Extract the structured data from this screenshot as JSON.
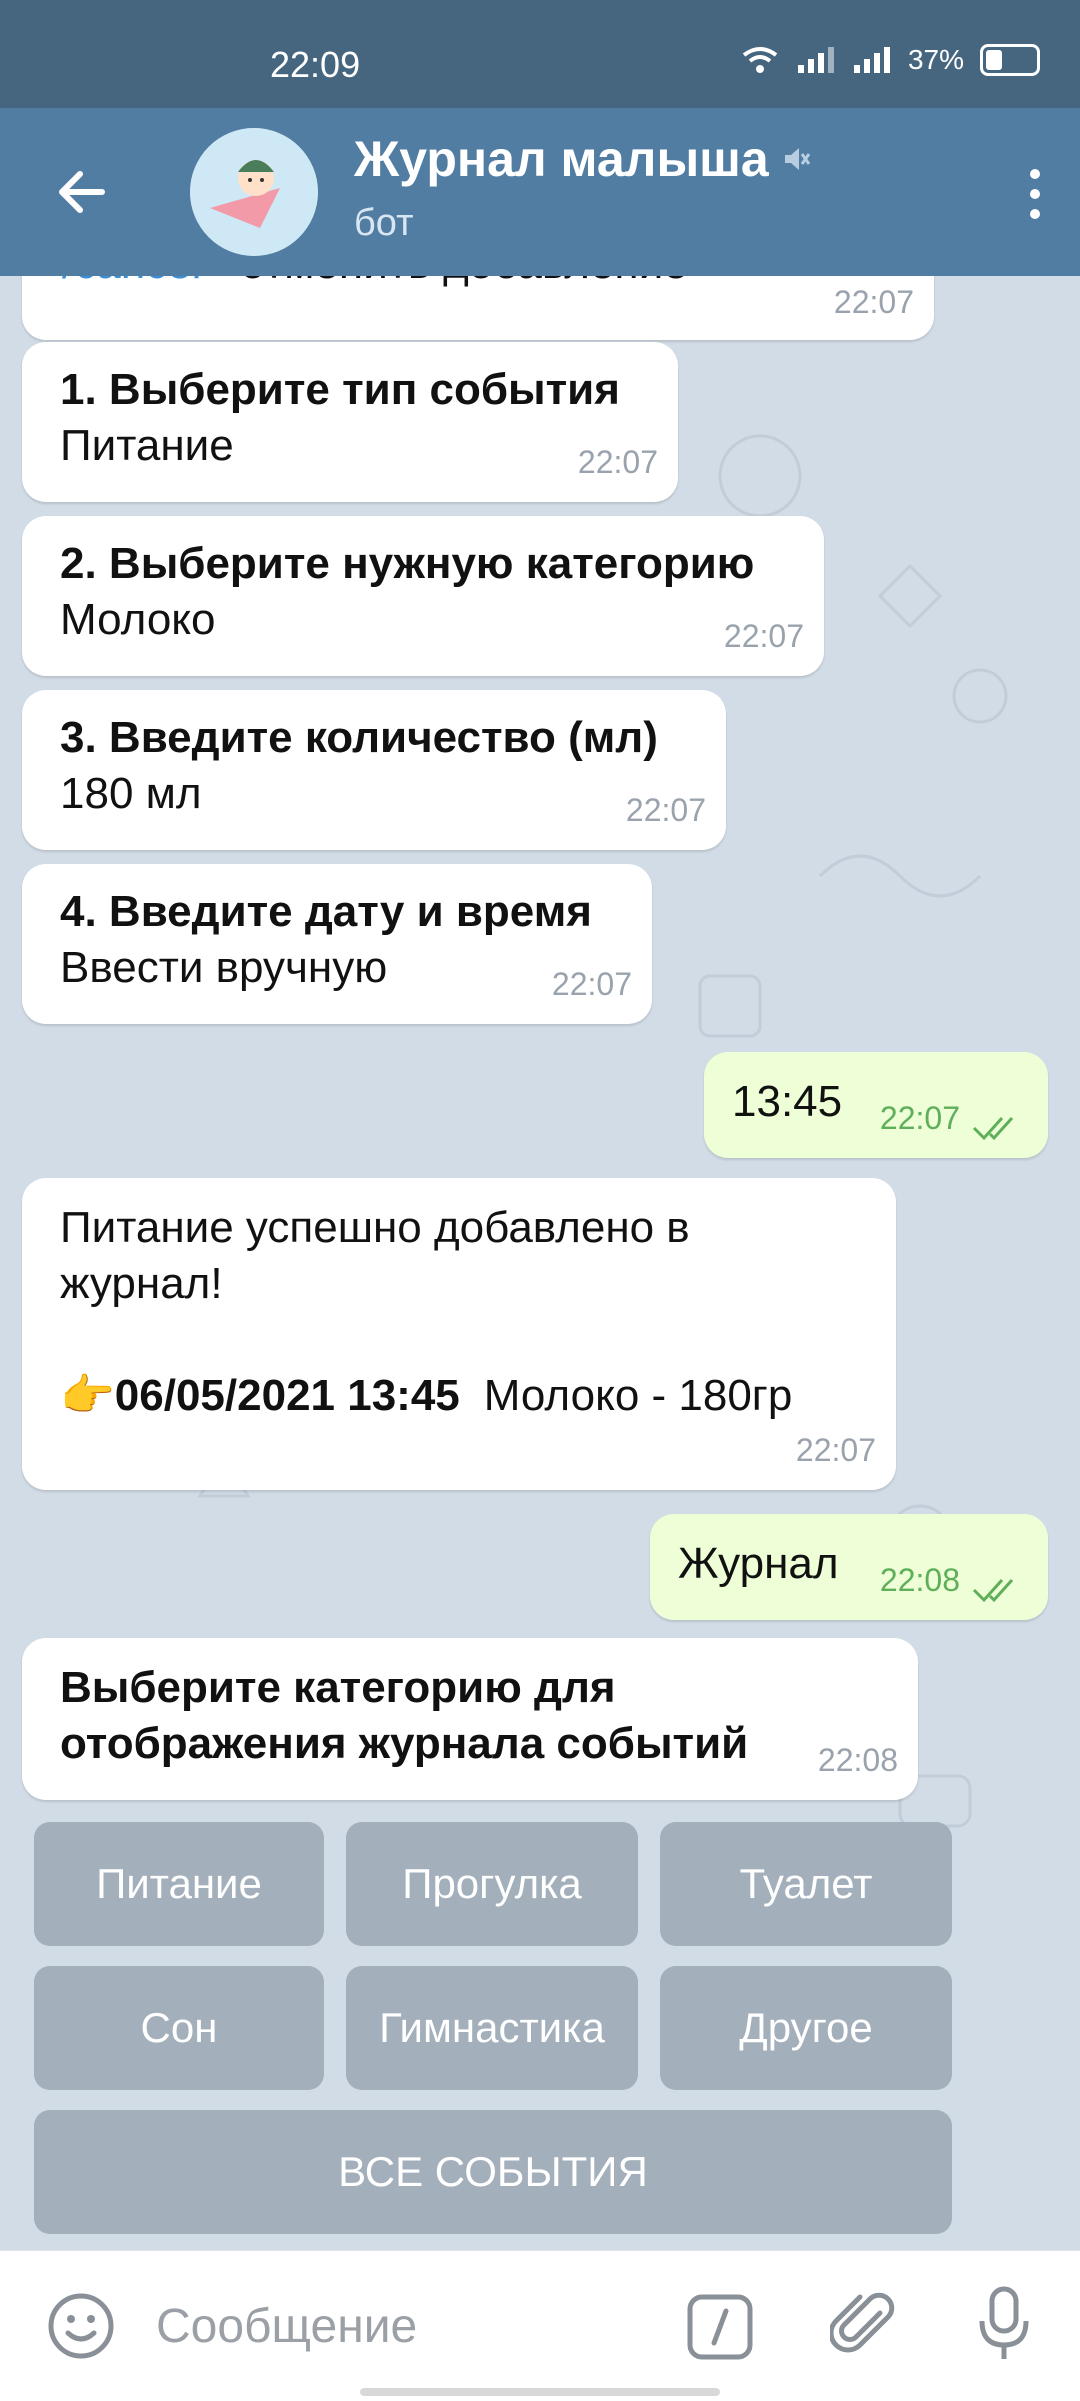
{
  "status": {
    "time": "22:09",
    "battery": "37%"
  },
  "header": {
    "title": "Журнал малыша",
    "subtitle": "бот"
  },
  "messages": [
    {
      "cmd": "/cancel",
      "text": " - отменить добавление",
      "time": "22:07"
    },
    {
      "title": "1. Выберите тип события",
      "value": "Питание",
      "time": "22:07"
    },
    {
      "title": "2. Выберите нужную категорию",
      "value": "Молоко",
      "time": "22:07"
    },
    {
      "title": "3. Введите количество (мл)",
      "value": "180 мл",
      "time": "22:07"
    },
    {
      "title": "4. Введите дату и время",
      "value": "Ввести вручную",
      "time": "22:07"
    },
    {
      "text": "13:45",
      "time": "22:07"
    },
    {
      "line1": "Питание успешно добавлено в",
      "line2": "журнал!",
      "emoji": "👉",
      "date": "06/05/2021 13:45",
      "entry": "Молоко - 180гр",
      "time": "22:07"
    },
    {
      "text": "Журнал",
      "time": "22:08"
    },
    {
      "line1": "Выберите категорию для",
      "line2": "отображения журнала событий",
      "time": "22:08"
    }
  ],
  "keyboard": {
    "row1": [
      "Питание",
      "Прогулка",
      "Туалет"
    ],
    "row2": [
      "Сон",
      "Гимнастика",
      "Другое"
    ],
    "all": "ВСЕ СОБЫТИЯ"
  },
  "input": {
    "placeholder": "Сообщение"
  },
  "icons": {
    "back": "arrow-left-icon",
    "mute": "muted-speaker-icon",
    "menu": "more-vertical-icon",
    "emoji": "smiley-icon",
    "command": "slash-command-icon",
    "attach": "paperclip-icon",
    "mic": "microphone-icon"
  },
  "colors": {
    "header": "#527da3",
    "statusbar": "#46657f",
    "outgoing": "#eefed7",
    "keyboard_button": "#a3afbb",
    "time_out": "#5fae5a",
    "link": "#3a8fd6"
  }
}
